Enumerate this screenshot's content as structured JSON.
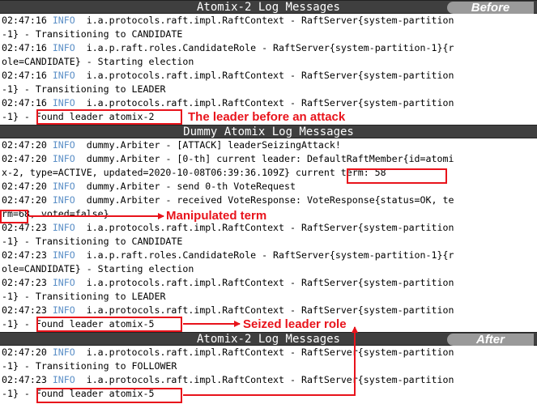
{
  "sections": [
    {
      "title": "Atomix-2 Log Messages",
      "badge": "Before",
      "lines": [
        {
          "ts": "02:47:16",
          "lvl": "INFO",
          "rest": "i.a.protocols.raft.impl.RaftContext - RaftServer{system-partition"
        },
        {
          "ts": "",
          "lvl": "",
          "rest": "-1} - Transitioning to CANDIDATE"
        },
        {
          "ts": "02:47:16",
          "lvl": "INFO",
          "rest": "i.a.p.raft.roles.CandidateRole - RaftServer{system-partition-1}{r"
        },
        {
          "ts": "",
          "lvl": "",
          "rest": "ole=CANDIDATE} - Starting election"
        },
        {
          "ts": "02:47:16",
          "lvl": "INFO",
          "rest": "i.a.protocols.raft.impl.RaftContext - RaftServer{system-partition"
        },
        {
          "ts": "",
          "lvl": "",
          "rest": "-1} - Transitioning to LEADER"
        },
        {
          "ts": "02:47:16",
          "lvl": "INFO",
          "rest": "i.a.protocols.raft.impl.RaftContext - RaftServer{system-partition"
        },
        {
          "ts": "",
          "lvl": "",
          "rest": "-1} - Found leader atomix-2"
        }
      ]
    },
    {
      "title": "Dummy Atomix Log Messages",
      "badge": "",
      "lines": [
        {
          "ts": "02:47:20",
          "lvl": "INFO",
          "rest": "dummy.Arbiter - [ATTACK] leaderSeizingAttack!"
        },
        {
          "ts": "02:47:20",
          "lvl": "INFO",
          "rest": "dummy.Arbiter - [0-th] current leader: DefaultRaftMember{id=atomi"
        },
        {
          "ts": "",
          "lvl": "",
          "rest": "x-2, type=ACTIVE, updated=2020-10-08T06:39:36.109Z} current term: 58"
        },
        {
          "ts": "02:47:20",
          "lvl": "INFO",
          "rest": "dummy.Arbiter - send 0-th VoteRequest"
        },
        {
          "ts": "02:47:20",
          "lvl": "INFO",
          "rest": "dummy.Arbiter - received VoteResponse: VoteResponse{status=OK, te"
        },
        {
          "ts": "",
          "lvl": "",
          "rest": "rm=68, voted=false}"
        },
        {
          "ts": "02:47:23",
          "lvl": "INFO",
          "rest": "i.a.protocols.raft.impl.RaftContext - RaftServer{system-partition"
        },
        {
          "ts": "",
          "lvl": "",
          "rest": "-1} - Transitioning to CANDIDATE"
        },
        {
          "ts": "02:47:23",
          "lvl": "INFO",
          "rest": "i.a.p.raft.roles.CandidateRole - RaftServer{system-partition-1}{r"
        },
        {
          "ts": "",
          "lvl": "",
          "rest": "ole=CANDIDATE} - Starting election"
        },
        {
          "ts": "02:47:23",
          "lvl": "INFO",
          "rest": "i.a.protocols.raft.impl.RaftContext - RaftServer{system-partition"
        },
        {
          "ts": "",
          "lvl": "",
          "rest": "-1} - Transitioning to LEADER"
        },
        {
          "ts": "02:47:23",
          "lvl": "INFO",
          "rest": "i.a.protocols.raft.impl.RaftContext - RaftServer{system-partition"
        },
        {
          "ts": "",
          "lvl": "",
          "rest": "-1} - Found leader atomix-5"
        }
      ]
    },
    {
      "title": "Atomix-2 Log Messages",
      "badge": "After",
      "lines": [
        {
          "ts": "02:47:20",
          "lvl": "INFO",
          "rest": "i.a.protocols.raft.impl.RaftContext - RaftServer{system-partition"
        },
        {
          "ts": "",
          "lvl": "",
          "rest": "-1} - Transitioning to FOLLOWER"
        },
        {
          "ts": "02:47:23",
          "lvl": "INFO",
          "rest": "i.a.protocols.raft.impl.RaftContext - RaftServer{system-partition"
        },
        {
          "ts": "",
          "lvl": "",
          "rest": "-1} - Found leader atomix-5"
        }
      ]
    }
  ],
  "annotations": {
    "leader_before": "The leader before an attack",
    "manipulated_term": "Manipulated term",
    "seized_leader": "Seized leader role"
  },
  "colors": {
    "highlight": "#e8131b",
    "info": "#5b8fc7",
    "header_bg": "#3f3f3f",
    "badge_bg": "#9a9a9a"
  }
}
